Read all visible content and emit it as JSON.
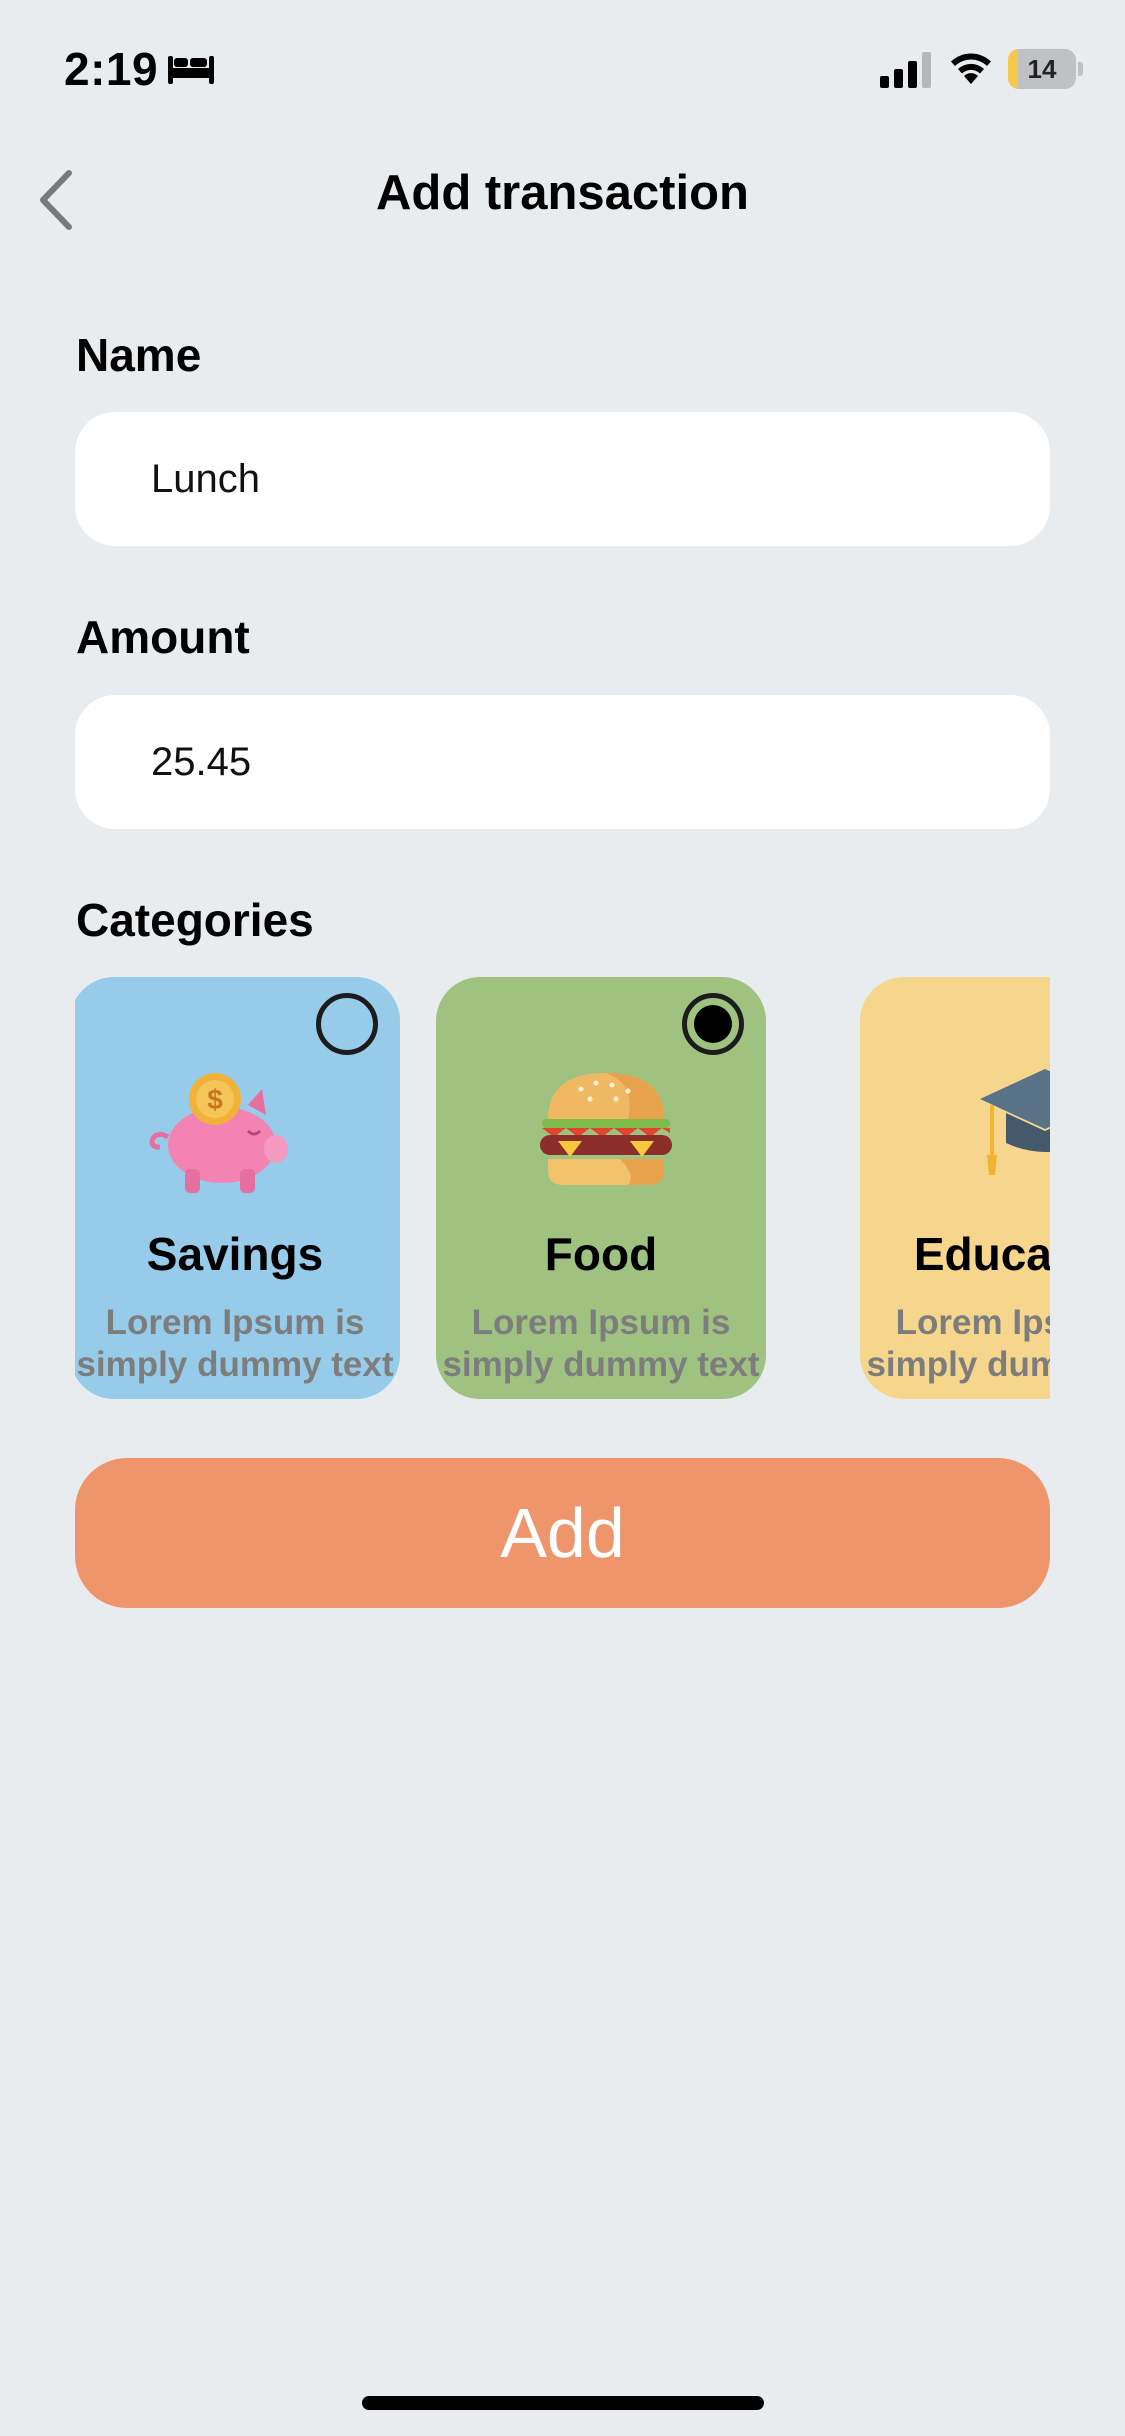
{
  "status_bar": {
    "time": "2:19",
    "battery_level": "14",
    "battery_fraction": 0.14
  },
  "nav": {
    "title": "Add transaction"
  },
  "form": {
    "name_label": "Name",
    "name_value": "Lunch",
    "amount_label": "Amount",
    "amount_value": "25.45",
    "categories_label": "Categories"
  },
  "categories": [
    {
      "title": "Savings",
      "desc_line1": "Lorem Ipsum is",
      "desc_line2": "simply dummy text",
      "selected": false,
      "color": "#96cbea",
      "icon": "piggy-bank-icon"
    },
    {
      "title": "Food",
      "desc_line1": "Lorem Ipsum is",
      "desc_line2": "simply dummy text",
      "selected": true,
      "color": "#9fc281",
      "icon": "burger-icon"
    },
    {
      "title": "Education",
      "desc_line1": "Lorem Ipsum is",
      "desc_line2": "simply dummy text",
      "selected": false,
      "color": "#f6d68c",
      "icon": "graduation-cap-icon"
    }
  ],
  "add_button_label": "Add",
  "colors": {
    "background": "#e9ecee",
    "accent": "#ef956b"
  }
}
